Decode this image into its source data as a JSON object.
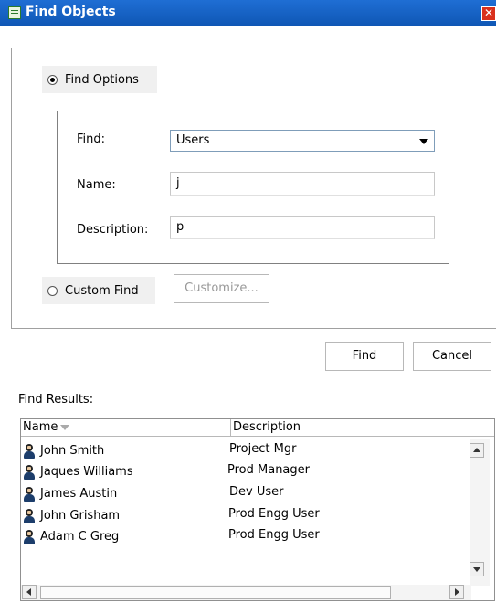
{
  "window": {
    "title": "Find Objects",
    "close_glyph": "✕"
  },
  "find_options": {
    "label": "Find Options",
    "find_label": "Find:",
    "find_value": "Users",
    "name_label": "Name:",
    "name_value": "j",
    "description_label": "Description:",
    "description_value": "p"
  },
  "custom_find": {
    "label": "Custom Find",
    "customize_label": "Customize..."
  },
  "actions": {
    "find_label": "Find",
    "cancel_label": "Cancel"
  },
  "results": {
    "label": "Find Results:",
    "columns": [
      "Name",
      "Description"
    ],
    "rows": [
      {
        "name": "John Smith",
        "description": "Project Mgr"
      },
      {
        "name": "Jaques Williams",
        "description": "Prod Manager"
      },
      {
        "name": "James Austin",
        "description": "Dev User"
      },
      {
        "name": "John Grisham",
        "description": "Prod Engg User"
      },
      {
        "name": "Adam C Greg",
        "description": "Prod Engg User"
      }
    ]
  }
}
